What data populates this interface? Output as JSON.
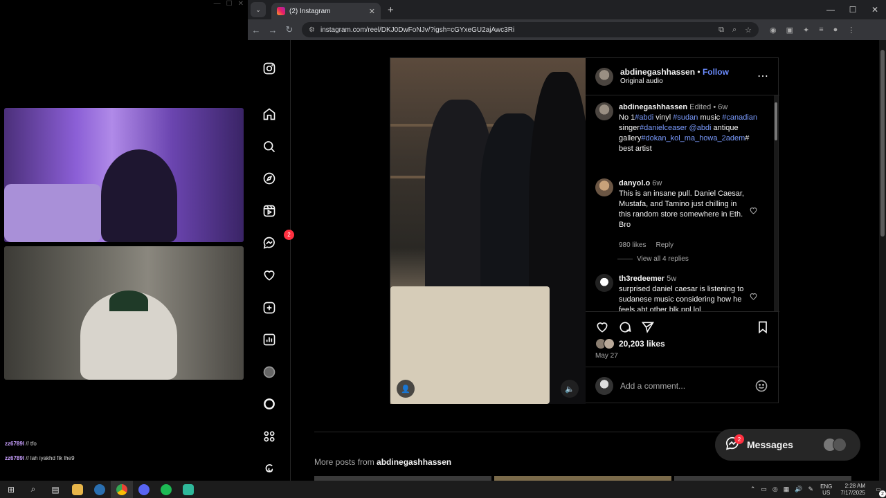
{
  "stream": {
    "chat": [
      {
        "user": "zz6789l",
        "message": "tfo"
      },
      {
        "user": "zz6789l",
        "message": "lah iyakhd fik lhe9"
      }
    ]
  },
  "browser": {
    "tab_title": "(2) Instagram",
    "url": "instagram.com/reel/DKJ0DwFoNJv/?igsh=cGYxeGU2ajAwc3Ri",
    "new_tab_label": "+"
  },
  "sidebar": {
    "messenger_badge": "2"
  },
  "post": {
    "author": "abdinegashhassen",
    "follow_label": "Follow",
    "separator": "•",
    "audio": "Original audio",
    "caption": {
      "user": "abdinegashhassen",
      "edited": "Edited •",
      "time": "6w",
      "parts": [
        "No 1",
        "#abdi",
        " vinyl ",
        "#sudan",
        " music ",
        "#canadian",
        " singer",
        "#danielceaser",
        " ",
        "@abdi",
        " antique gallery",
        "#dokan_kol_ma_howa_2adem",
        "# best artist"
      ]
    },
    "comments": [
      {
        "user": "danyol.o",
        "time": "6w",
        "text": "This is an insane pull. Daniel Caesar, Mustafa, and Tamino just chilling in this random store somewhere in Eth. Bro",
        "likes": "980 likes",
        "reply": "Reply",
        "view_replies": "View all 4 replies"
      },
      {
        "user": "th3redeemer",
        "time": "5w",
        "text": "surprised daniel caesar is listening to sudanese music considering how he feels abt other blk ppl lol"
      }
    ],
    "likes": "20,203 likes",
    "date": "May 27",
    "comment_placeholder": "Add a comment..."
  },
  "more_posts": {
    "prefix": "More posts from",
    "author": "abdinegashhassen"
  },
  "messages": {
    "label": "Messages",
    "badge": "2"
  },
  "taskbar": {
    "lang_top": "ENG",
    "lang_bottom": "US",
    "time": "2:28 AM",
    "date": "7/17/2025",
    "notif_count": "2"
  },
  "colors": {
    "accent_blue": "#6b8cff",
    "badge_red": "#ff3040",
    "hashtag": "#7b9cff"
  }
}
